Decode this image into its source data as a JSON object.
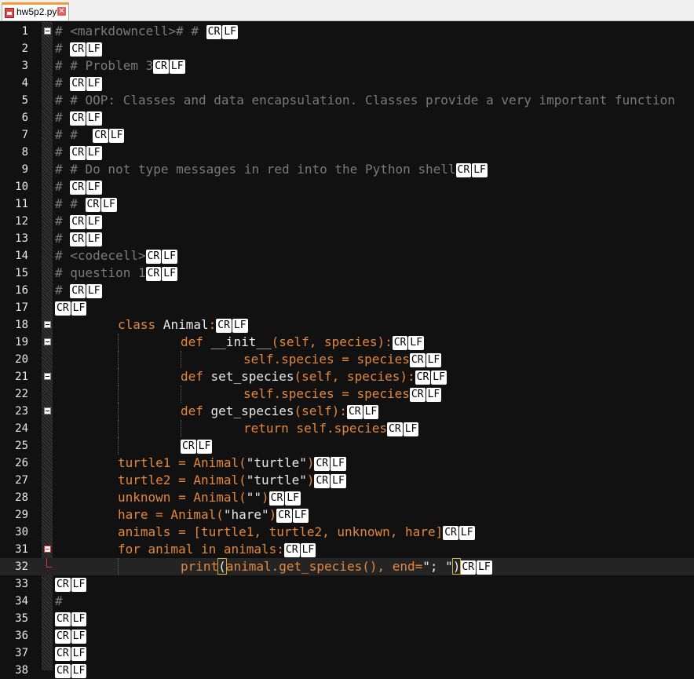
{
  "tab": {
    "filename": "hw5p2.py",
    "close_glyph": "✕"
  },
  "eol": {
    "cr": "CR",
    "lf": "LF"
  },
  "colors": {
    "background": "#111111",
    "comment": "#7a7a7a",
    "keyword": "#e5873c",
    "text": "#e8e8e8",
    "current_line": "#242424",
    "fold_marker_active": "#e03030"
  },
  "editor": {
    "current_line": 32,
    "lines": [
      {
        "n": "1",
        "fold": "box",
        "tokens": [
          {
            "t": "# <markdowncell># # ",
            "c": "cm"
          }
        ],
        "eol": true
      },
      {
        "n": "2",
        "tokens": [
          {
            "t": "# ",
            "c": "cm"
          }
        ],
        "eol": true
      },
      {
        "n": "3",
        "tokens": [
          {
            "t": "# # Problem 3",
            "c": "cm"
          }
        ],
        "eol": true
      },
      {
        "n": "4",
        "tokens": [
          {
            "t": "# ",
            "c": "cm"
          }
        ],
        "eol": true
      },
      {
        "n": "5",
        "tokens": [
          {
            "t": "# # OOP: Classes and data encapsulation. Classes provide a very important function",
            "c": "cm"
          }
        ],
        "eol": false
      },
      {
        "n": "6",
        "tokens": [
          {
            "t": "# ",
            "c": "cm"
          }
        ],
        "eol": true
      },
      {
        "n": "7",
        "tokens": [
          {
            "t": "# #  ",
            "c": "cm"
          }
        ],
        "eol": true
      },
      {
        "n": "8",
        "tokens": [
          {
            "t": "# ",
            "c": "cm"
          }
        ],
        "eol": true
      },
      {
        "n": "9",
        "tokens": [
          {
            "t": "# # Do not type messages in red into the Python shell",
            "c": "cm"
          }
        ],
        "eol": true
      },
      {
        "n": "10",
        "tokens": [
          {
            "t": "# ",
            "c": "cm"
          }
        ],
        "eol": true
      },
      {
        "n": "11",
        "tokens": [
          {
            "t": "# # ",
            "c": "cm"
          }
        ],
        "eol": true
      },
      {
        "n": "12",
        "tokens": [
          {
            "t": "# ",
            "c": "cm"
          }
        ],
        "eol": true
      },
      {
        "n": "13",
        "tokens": [
          {
            "t": "# ",
            "c": "cm"
          }
        ],
        "eol": true
      },
      {
        "n": "14",
        "tokens": [
          {
            "t": "# <codecell>",
            "c": "cm"
          }
        ],
        "eol": true
      },
      {
        "n": "15",
        "tokens": [
          {
            "t": "# question 1",
            "c": "cm"
          }
        ],
        "eol": true
      },
      {
        "n": "16",
        "tokens": [
          {
            "t": "# ",
            "c": "cm"
          }
        ],
        "eol": true
      },
      {
        "n": "17",
        "tokens": [],
        "eol": true
      },
      {
        "n": "18",
        "fold": "box",
        "indent": 1,
        "tokens": [
          {
            "t": "class",
            "c": "kw"
          },
          {
            "t": " Animal",
            "c": "nm"
          },
          {
            "t": ":",
            "c": "pa"
          }
        ],
        "eol": true
      },
      {
        "n": "19",
        "fold": "box",
        "indent": 2,
        "tokens": [
          {
            "t": "def",
            "c": "kw"
          },
          {
            "t": " __init__",
            "c": "nm"
          },
          {
            "t": "(self, species):",
            "c": "kw"
          }
        ],
        "eol": true
      },
      {
        "n": "20",
        "indent": 3,
        "tokens": [
          {
            "t": "self.species = species",
            "c": "kw"
          }
        ],
        "eol": true
      },
      {
        "n": "21",
        "fold": "box",
        "indent": 2,
        "tokens": [
          {
            "t": "def",
            "c": "kw"
          },
          {
            "t": " set_species",
            "c": "nm"
          },
          {
            "t": "(self, species):",
            "c": "kw"
          }
        ],
        "eol": true
      },
      {
        "n": "22",
        "indent": 3,
        "tokens": [
          {
            "t": "self.species = species",
            "c": "kw"
          }
        ],
        "eol": true
      },
      {
        "n": "23",
        "fold": "box",
        "indent": 2,
        "tokens": [
          {
            "t": "def",
            "c": "kw"
          },
          {
            "t": " get_species",
            "c": "nm"
          },
          {
            "t": "(self):",
            "c": "kw"
          }
        ],
        "eol": true
      },
      {
        "n": "24",
        "indent": 3,
        "tokens": [
          {
            "t": "return self.species",
            "c": "kw"
          }
        ],
        "eol": true
      },
      {
        "n": "25",
        "indent": 2,
        "tokens": [],
        "eol": true
      },
      {
        "n": "26",
        "indent": 1,
        "tokens": [
          {
            "t": "turtle1 = Animal(",
            "c": "kw"
          },
          {
            "t": "\"turtle\"",
            "c": "st"
          },
          {
            "t": ")",
            "c": "kw"
          }
        ],
        "eol": true
      },
      {
        "n": "27",
        "indent": 1,
        "tokens": [
          {
            "t": "turtle2 = Animal(",
            "c": "kw"
          },
          {
            "t": "\"turtle\"",
            "c": "st"
          },
          {
            "t": ")",
            "c": "kw"
          }
        ],
        "eol": true
      },
      {
        "n": "28",
        "indent": 1,
        "tokens": [
          {
            "t": "unknown = Animal(",
            "c": "kw"
          },
          {
            "t": "\"\"",
            "c": "st"
          },
          {
            "t": ")",
            "c": "kw"
          }
        ],
        "eol": true
      },
      {
        "n": "29",
        "indent": 1,
        "tokens": [
          {
            "t": "hare = Animal(",
            "c": "kw"
          },
          {
            "t": "\"hare\"",
            "c": "st"
          },
          {
            "t": ")",
            "c": "kw"
          }
        ],
        "eol": true
      },
      {
        "n": "30",
        "indent": 1,
        "tokens": [
          {
            "t": "animals = [turtle1, turtle2, unknown, hare]",
            "c": "kw"
          }
        ],
        "eol": true
      },
      {
        "n": "31",
        "fold": "red",
        "indent": 1,
        "tokens": [
          {
            "t": "for animal in animals:",
            "c": "kw"
          }
        ],
        "eol": true
      },
      {
        "n": "32",
        "fold": "end",
        "indent": 2,
        "tokens": [
          {
            "t": "print",
            "c": "kw"
          },
          {
            "t": "(",
            "c": "hl"
          },
          {
            "t": "animal.get_species(), end=",
            "c": "kw"
          },
          {
            "t": "\"; \"",
            "c": "st"
          },
          {
            "t": ")",
            "c": "hl"
          }
        ],
        "eol": true
      },
      {
        "n": "33",
        "tokens": [],
        "eol": true
      },
      {
        "n": "34",
        "tokens": [
          {
            "t": "#",
            "c": "cm"
          }
        ],
        "eol": false
      },
      {
        "n": "35",
        "tokens": [],
        "eol": true
      },
      {
        "n": "36",
        "tokens": [],
        "eol": true
      },
      {
        "n": "37",
        "tokens": [],
        "eol": true
      },
      {
        "n": "38",
        "tokens": [],
        "eol": true
      }
    ]
  }
}
